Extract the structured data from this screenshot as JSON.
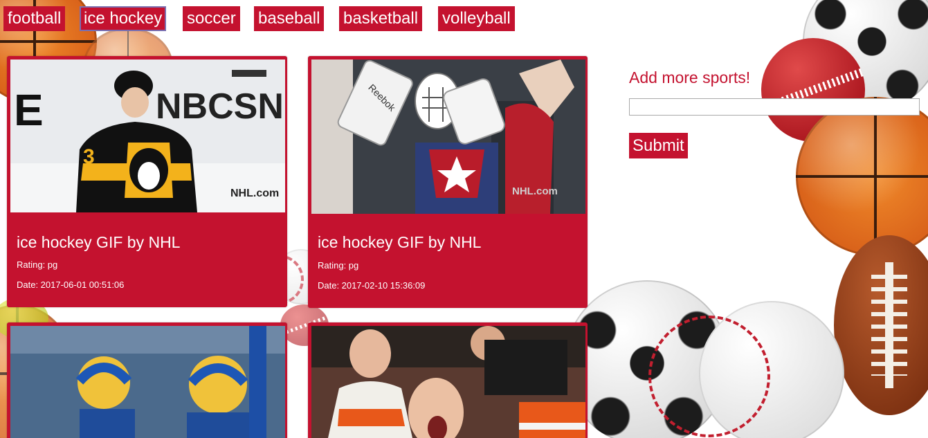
{
  "nav": {
    "buttons": [
      {
        "label": "football"
      },
      {
        "label": "ice hockey",
        "active": true
      },
      {
        "label": "soccer"
      },
      {
        "label": "baseball"
      },
      {
        "label": "basketball"
      },
      {
        "label": "volleyball"
      }
    ]
  },
  "cards": [
    {
      "title": "ice hockey GIF by NHL",
      "rating": "Rating: pg",
      "date": "Date: 2017-06-01 00:51:06",
      "image": "hockey-player-gif",
      "watermark": "NHL.com",
      "logo": "NBCSN"
    },
    {
      "title": "ice hockey GIF by NHL",
      "rating": "Rating: pg",
      "date": "Date: 2017-02-10 15:36:09",
      "image": "goalie-fan-gif",
      "watermark": "NHL.com",
      "brand": "Reebok"
    },
    {
      "image": "blues-fans-gif"
    },
    {
      "image": "cheering-fans-gif"
    }
  ],
  "sidebar": {
    "heading": "Add more sports!",
    "input_value": "",
    "submit_label": "Submit"
  },
  "colors": {
    "accent": "#c4122f",
    "text_on_accent": "#ffffff"
  }
}
